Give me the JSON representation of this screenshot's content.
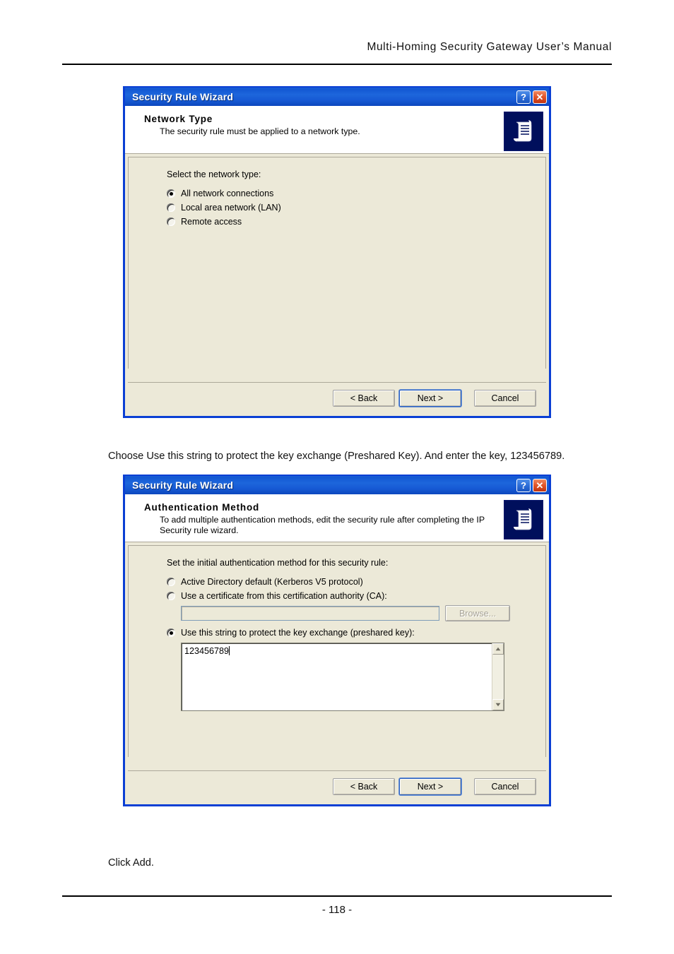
{
  "page": {
    "header_title": "Multi-Homing Security Gateway User’s Manual",
    "header_words": [
      "Multi-Homing",
      "Security",
      "Gateway",
      "User’s",
      "Manual"
    ],
    "page_number": "- 118 -"
  },
  "captions": {
    "caption_1": "Choose Use this string to protect the key exchange (Preshared Key). And enter the key, 123456789.",
    "caption_2": "Click Add."
  },
  "icons": {
    "help": "?",
    "close": "✕",
    "scroll_document": "scroll-document-icon"
  },
  "colors": {
    "titlebar_blue": "#1657d2",
    "dialog_border": "#0a3fd4",
    "dialog_face": "#ece9d8",
    "banner_icon_bg": "#000f5c",
    "close_red": "#e2562a",
    "default_button_focus": "#2a5fbe"
  },
  "dialog_network_type": {
    "title": "Security Rule Wizard",
    "banner_title": "Network Type",
    "banner_subtitle": "The security rule must be applied to a network type.",
    "prompt": "Select the network type:",
    "options": [
      {
        "label": "All network connections",
        "checked": true
      },
      {
        "label": "Local area network (LAN)",
        "checked": false
      },
      {
        "label": "Remote access",
        "checked": false
      }
    ],
    "buttons": {
      "back": "< Back",
      "next": "Next >",
      "cancel": "Cancel"
    }
  },
  "dialog_auth_method": {
    "title": "Security Rule Wizard",
    "banner_title": "Authentication Method",
    "banner_subtitle": "To add multiple authentication methods, edit the security rule after completing the IP Security rule wizard.",
    "prompt": "Set the initial authentication method for this security rule:",
    "options": [
      {
        "label": "Active Directory default (Kerberos V5 protocol)",
        "checked": false
      },
      {
        "label": "Use a certificate from this certification authority (CA):",
        "checked": false
      },
      {
        "label": "Use this string to protect the key exchange (preshared key):",
        "checked": true
      }
    ],
    "ca_field_value": "",
    "browse_button": "Browse...",
    "preshared_key_value": "123456789",
    "buttons": {
      "back": "< Back",
      "next": "Next >",
      "cancel": "Cancel"
    }
  }
}
